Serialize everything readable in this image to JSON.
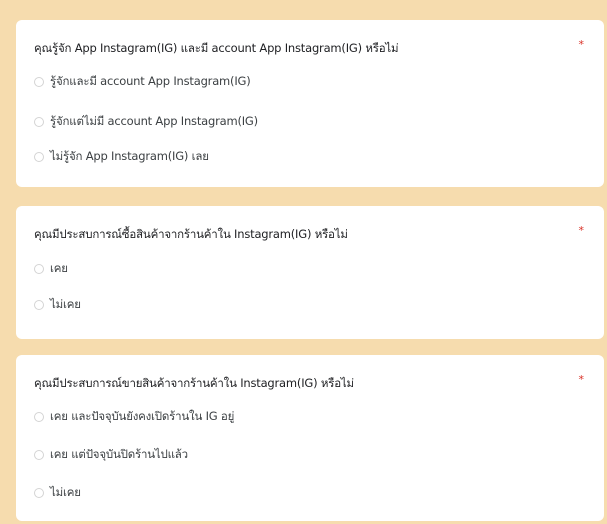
{
  "required_mark": "*",
  "questions": [
    {
      "title": "คุณรู้จัก App Instagram(IG) และมี account App Instagram(IG) หรือไม่",
      "options": [
        "รู้จักและมี account App Instagram(IG)",
        "รู้จักแต่ไม่มี account App Instagram(IG)",
        "ไม่รู้จัก App Instagram(IG) เลย"
      ]
    },
    {
      "title": "คุณมีประสบการณ์ซื้อสินค้าจากร้านค้าใน Instagram(IG) หรือไม่",
      "options": [
        "เคย",
        "ไม่เคย"
      ]
    },
    {
      "title": "คุณมีประสบการณ์ขายสินค้าจากร้านค้าใน Instagram(IG) หรือไม่",
      "options": [
        "เคย และปัจจุบันยังคงเปิดร้านใน IG อยู่",
        "เคย แต่ปัจจุบันปิดร้านไปแล้ว",
        "ไม่เคย"
      ]
    }
  ],
  "colors": {
    "page_background": "#f6dcae",
    "card_background": "#ffffff",
    "required_mark": "#d93025",
    "radio_border": "#d4d4d4"
  }
}
